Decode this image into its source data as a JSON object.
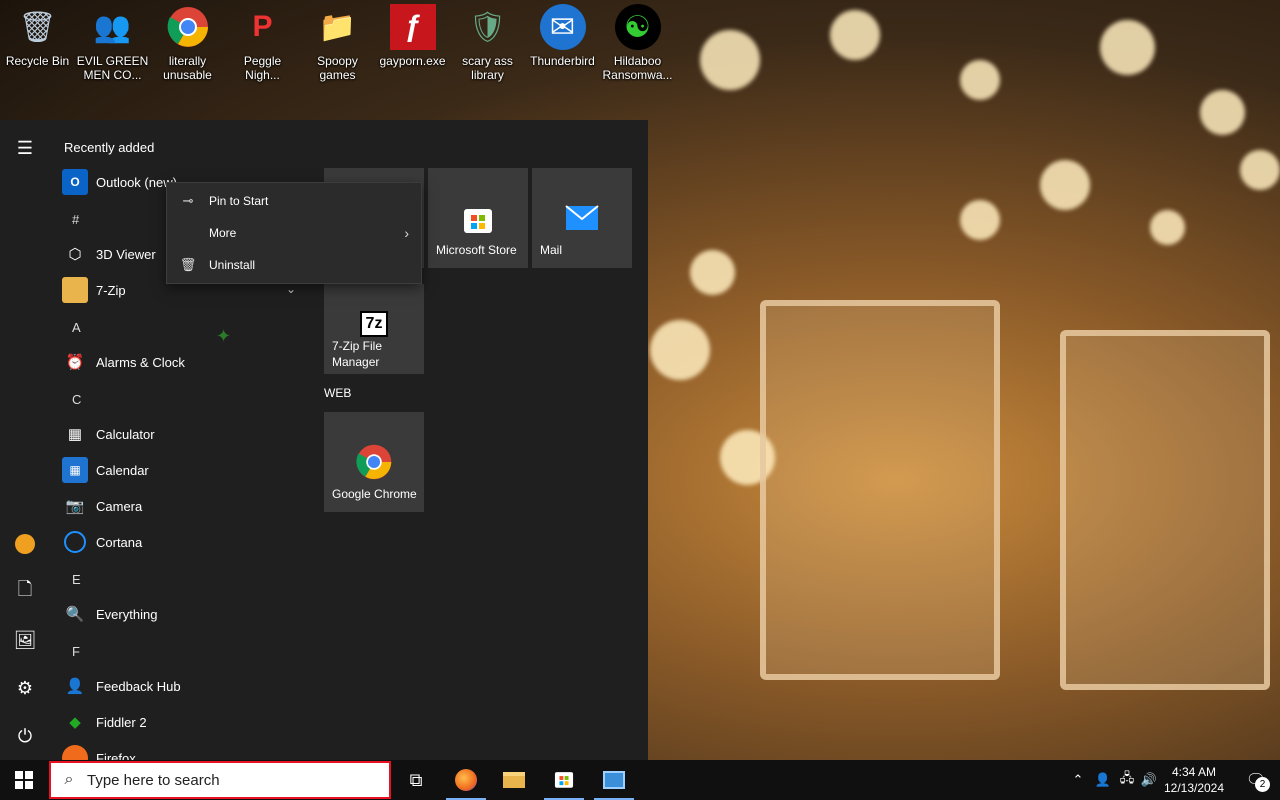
{
  "desktop": {
    "icons": [
      {
        "label": "Recycle Bin",
        "icon": "recycle-bin-icon",
        "glyph": "🗑"
      },
      {
        "label": "EVIL GREEN\nMEN CO...",
        "icon": "green-men-icon",
        "glyph": "👥"
      },
      {
        "label": "literally\nunusable",
        "icon": "chrome-icon",
        "glyph": "◉"
      },
      {
        "label": "Peggle\nNigh...",
        "icon": "peggle-icon",
        "glyph": "P"
      },
      {
        "label": "Spoopy\ngames",
        "icon": "folder-games-icon",
        "glyph": "📁"
      },
      {
        "label": "gayporn.exe",
        "icon": "flash-icon",
        "glyph": "ƒ"
      },
      {
        "label": "scary ass\nlibrary",
        "icon": "library-icon",
        "glyph": "🛡"
      },
      {
        "label": "Thunderbird",
        "icon": "thunderbird-icon",
        "glyph": "✉"
      },
      {
        "label": "Hildaboo\nRansomwa...",
        "icon": "yashma-icon",
        "glyph": "☯"
      }
    ]
  },
  "start_menu": {
    "recently_added_title": "Recently added",
    "recent_app": "Outlook (new)",
    "letters": {
      "hash": "#",
      "a": "A",
      "c": "C",
      "e": "E",
      "f": "F"
    },
    "apps": {
      "viewer3d": "3D Viewer",
      "zip": "7-Zip",
      "alarms": "Alarms & Clock",
      "calculator": "Calculator",
      "calendar": "Calendar",
      "camera": "Camera",
      "cortana": "Cortana",
      "everything": "Everything",
      "feedback": "Feedback Hub",
      "fiddler": "Fiddler 2",
      "firefox": "Firefox"
    },
    "tiles": {
      "store": "Microsoft Store",
      "mail": "Mail",
      "zipfm": "7-Zip File\nManager",
      "chrome": "Google Chrome"
    },
    "group_web": "WEB",
    "context_menu": {
      "pin": "Pin to Start",
      "more": "More",
      "uninstall": "Uninstall"
    }
  },
  "taskbar": {
    "search_placeholder": "Type here to search",
    "clock_time": "4:34 AM",
    "clock_date": "12/13/2024",
    "notification_count": "2"
  },
  "colors": {
    "accent_red": "#e81123",
    "start_bg": "#1f1f1f",
    "tile_bg": "#3a3a3a"
  }
}
